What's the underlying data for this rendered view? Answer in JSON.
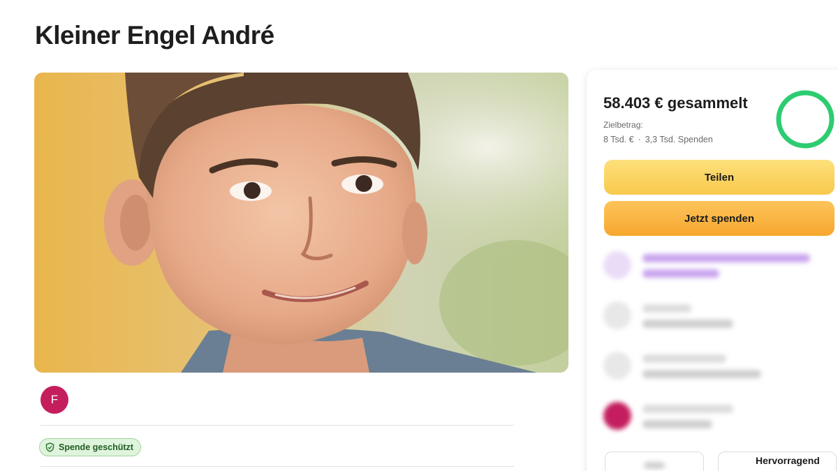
{
  "campaign": {
    "title": "Kleiner Engel André"
  },
  "organizer": {
    "avatar_initial": "F",
    "avatar_color": "#c41e5e"
  },
  "badge": {
    "protected_label": "Spende geschützt"
  },
  "stats": {
    "raised_label": "58.403 € gesammelt",
    "goal_label": "Zielbetrag:",
    "goal_value": "8 Tsd. €",
    "separator": "·",
    "donation_count": "3,3 Tsd. Spenden",
    "progress_fraction": 1.0
  },
  "actions": {
    "share_label": "Teilen",
    "donate_label": "Jetzt spenden"
  },
  "bottom": {
    "popular_label": "Hervorragend"
  },
  "colors": {
    "progress_ring": "#2ecc71",
    "share_button": "#f8c94d",
    "donate_button": "#f7a72e",
    "badge_bg": "#dff4dc",
    "accent_purple": "#8b3fd1"
  }
}
